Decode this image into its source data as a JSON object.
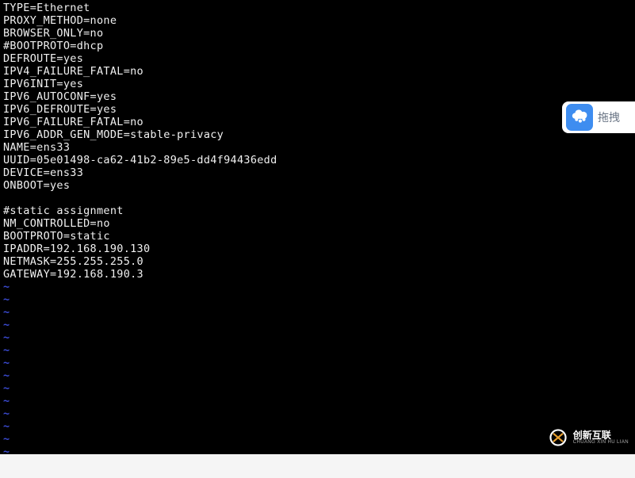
{
  "terminal": {
    "lines": [
      "TYPE=Ethernet",
      "PROXY_METHOD=none",
      "BROWSER_ONLY=no",
      "#BOOTPROTO=dhcp",
      "DEFROUTE=yes",
      "IPV4_FAILURE_FATAL=no",
      "IPV6INIT=yes",
      "IPV6_AUTOCONF=yes",
      "IPV6_DEFROUTE=yes",
      "IPV6_FAILURE_FATAL=no",
      "IPV6_ADDR_GEN_MODE=stable-privacy",
      "NAME=ens33",
      "UUID=05e01498-ca62-41b2-89e5-dd4f94436edd",
      "DEVICE=ens33",
      "ONBOOT=yes",
      "",
      "#static assignment",
      "NM_CONTROLLED=no",
      "BOOTPROTO=static",
      "IPADDR=192.168.190.130",
      "NETMASK=255.255.255.0",
      "GATEWAY=192.168.190.3"
    ],
    "tilde": "~",
    "tilde_count": 14
  },
  "overlay": {
    "label": "拖拽"
  },
  "brand": {
    "cn": "创新互联",
    "en": "CHUANG XIN HU LIAN"
  }
}
